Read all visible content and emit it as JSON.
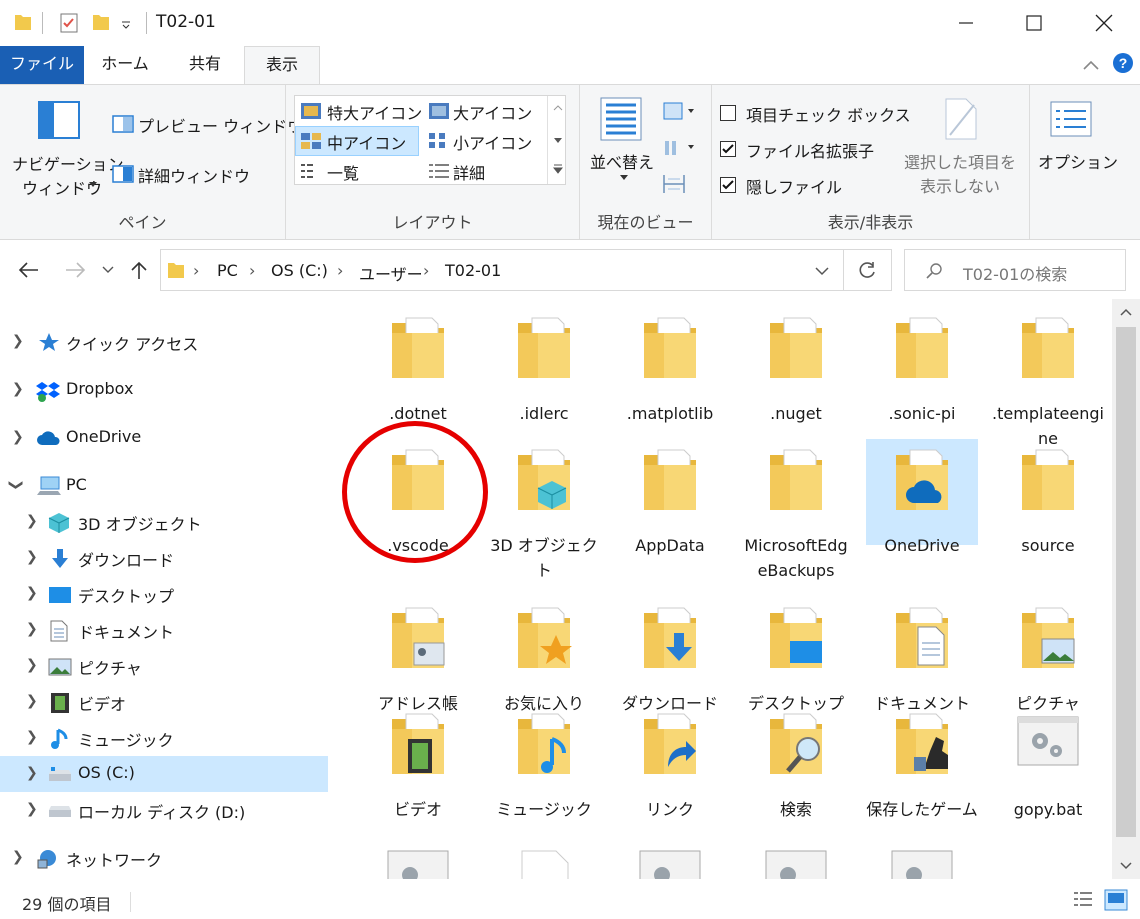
{
  "window": {
    "title": "T02-01"
  },
  "ribbon_tabs": [
    "ファイル",
    "ホーム",
    "共有",
    "表示"
  ],
  "ribbon": {
    "pane": {
      "nav_pane_line1": "ナビゲーション",
      "nav_pane_line2": "ウィンドウ",
      "preview_pane": "プレビュー ウィンドウ",
      "details_pane": "詳細ウィンドウ",
      "label": "ペイン"
    },
    "layout": {
      "options": [
        "特大アイコン",
        "大アイコン",
        "中アイコン",
        "小アイコン",
        "一覧",
        "詳細"
      ],
      "selected": "中アイコン",
      "label": "レイアウト"
    },
    "current_view": {
      "sort_by": "並べ替え",
      "label": "現在のビュー"
    },
    "show_hide": {
      "item_checkboxes": "項目チェック ボックス",
      "item_checkboxes_checked": false,
      "file_extensions": "ファイル名拡張子",
      "file_extensions_checked": true,
      "hidden_items": "隠しファイル",
      "hidden_items_checked": true,
      "hide_selected_line1": "選択した項目を",
      "hide_selected_line2": "表示しない",
      "label": "表示/非表示"
    },
    "options": "オプション"
  },
  "address": {
    "crumbs": [
      "PC",
      "OS (C:)",
      "ユーザー",
      "T02-01"
    ],
    "search_placeholder": "T02-01の検索"
  },
  "nav": [
    {
      "label": "クイック アクセス",
      "icon": "star-icon"
    },
    {
      "label": "Dropbox",
      "icon": "dropbox-icon"
    },
    {
      "label": "OneDrive",
      "icon": "cloud-icon"
    },
    {
      "label": "PC",
      "icon": "pc-icon"
    },
    {
      "label": "3D オブジェクト",
      "icon": "3d-icon"
    },
    {
      "label": "ダウンロード",
      "icon": "download-icon"
    },
    {
      "label": "デスクトップ",
      "icon": "desktop-icon"
    },
    {
      "label": "ドキュメント",
      "icon": "document-icon"
    },
    {
      "label": "ピクチャ",
      "icon": "picture-icon"
    },
    {
      "label": "ビデオ",
      "icon": "video-icon"
    },
    {
      "label": "ミュージック",
      "icon": "music-icon"
    },
    {
      "label": "OS (C:)",
      "icon": "drive-icon"
    },
    {
      "label": "ローカル ディスク (D:)",
      "icon": "drive-icon"
    },
    {
      "label": "ネットワーク",
      "icon": "network-icon"
    }
  ],
  "items": [
    {
      "label": ".dotnet",
      "icon": "folder-icon"
    },
    {
      "label": ".idlerc",
      "icon": "folder-icon"
    },
    {
      "label": ".matplotlib",
      "icon": "folder-icon"
    },
    {
      "label": ".nuget",
      "icon": "folder-icon"
    },
    {
      "label": ".sonic-pi",
      "icon": "folder-icon"
    },
    {
      "label": ".templateengine",
      "icon": "folder-icon"
    },
    {
      "label": ".vscode",
      "icon": "folder-icon"
    },
    {
      "label": "3D オブジェクト",
      "icon": "3d-folder-icon"
    },
    {
      "label": "AppData",
      "icon": "folder-icon"
    },
    {
      "label": "MicrosoftEdgeBackups",
      "icon": "folder-icon"
    },
    {
      "label": "OneDrive",
      "icon": "onedrive-folder-icon"
    },
    {
      "label": "source",
      "icon": "folder-icon"
    },
    {
      "label": "アドレス帳",
      "icon": "contacts-folder-icon"
    },
    {
      "label": "お気に入り",
      "icon": "favorites-folder-icon"
    },
    {
      "label": "ダウンロード",
      "icon": "download-folder-icon"
    },
    {
      "label": "デスクトップ",
      "icon": "desktop-folder-icon"
    },
    {
      "label": "ドキュメント",
      "icon": "document-folder-icon"
    },
    {
      "label": "ピクチャ",
      "icon": "picture-folder-icon"
    },
    {
      "label": "ビデオ",
      "icon": "video-folder-icon"
    },
    {
      "label": "ミュージック",
      "icon": "music-folder-icon"
    },
    {
      "label": "リンク",
      "icon": "link-folder-icon"
    },
    {
      "label": "検索",
      "icon": "search-folder-icon"
    },
    {
      "label": "保存したゲーム",
      "icon": "games-folder-icon"
    },
    {
      "label": "gopy.bat",
      "icon": "batch-file-icon"
    }
  ],
  "status": {
    "count": "29 個の項目"
  },
  "colors": {
    "accent": "#1a5fb4",
    "selection": "#cce8ff",
    "folder": "#f8d775",
    "annotation": "#e50000"
  }
}
